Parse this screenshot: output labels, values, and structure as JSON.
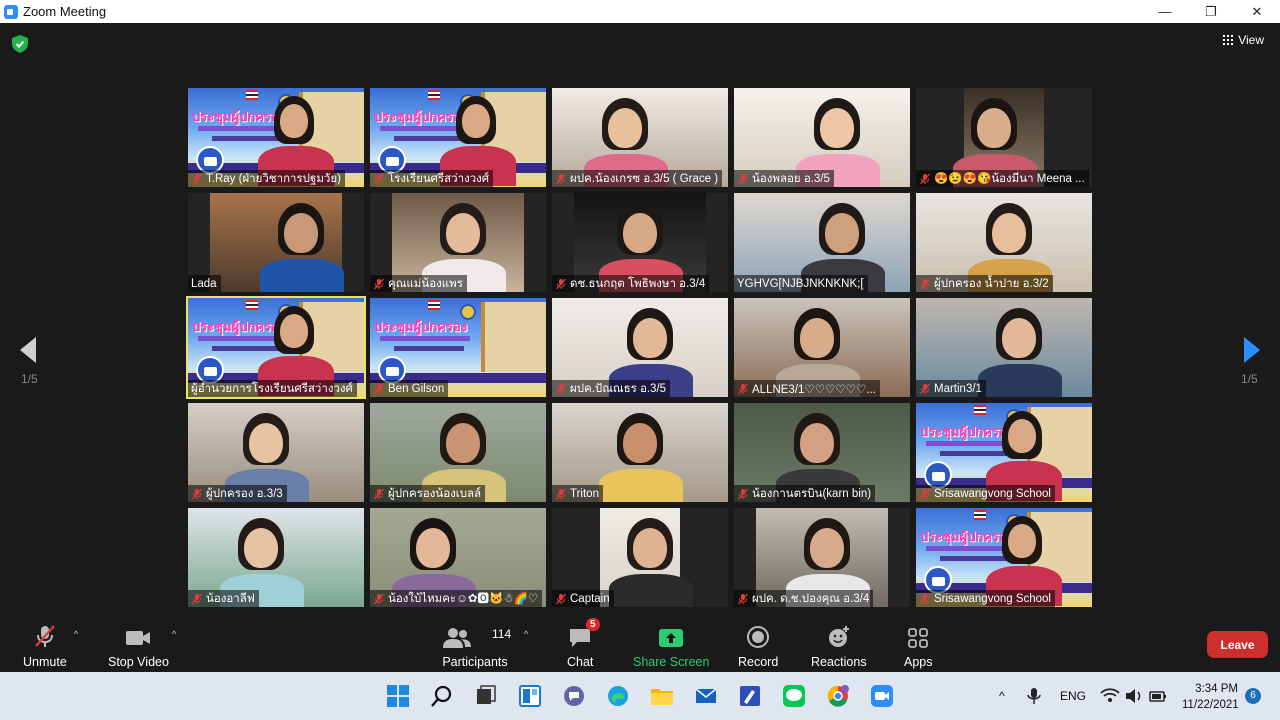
{
  "window": {
    "title": "Zoom Meeting",
    "minimize_glyph": "—",
    "restore_glyph": "❐",
    "close_glyph": "✕"
  },
  "meeting": {
    "view_label": "View",
    "page_left": "1/5",
    "page_right": "1/5",
    "banner_title": "ประชุมผู้ปกครอง"
  },
  "tiles": [
    {
      "name": "T.Ray (ฝ่ายวิชาการปฐมวัย)",
      "muted": true,
      "kind": "banner-person"
    },
    {
      "name": "โรงเรียนศรีสว่างวงศ์",
      "muted": true,
      "kind": "banner-person"
    },
    {
      "name": "ผปค.น้องเกรซ อ.3/5 ( Grace )",
      "muted": true,
      "kind": "person"
    },
    {
      "name": "น้องพลอย อ.3/5",
      "muted": true,
      "kind": "person"
    },
    {
      "name": "😍😉😍😘น้องมีนา Meena ...",
      "muted": true,
      "kind": "person"
    },
    {
      "name": "Lada",
      "muted": false,
      "kind": "person"
    },
    {
      "name": "คุณแม่น้องแพร",
      "muted": true,
      "kind": "person"
    },
    {
      "name": "ดช.ธนกฤต โพธิพงษา อ.3/4",
      "muted": true,
      "kind": "person"
    },
    {
      "name": "YGHVG[NJBJNKNKNK;[",
      "muted": false,
      "kind": "person"
    },
    {
      "name": "ผู้ปกครอง น้ำปาย อ.3/2",
      "muted": true,
      "kind": "person"
    },
    {
      "name": "ผู้อำนวยการโรงเรียนศรีสว่างวงศ์",
      "muted": false,
      "kind": "banner-person",
      "active": true
    },
    {
      "name": "Ben Gilson",
      "muted": true,
      "kind": "banner"
    },
    {
      "name": "ผปค.ปัณณธร อ.3/5",
      "muted": true,
      "kind": "person"
    },
    {
      "name": "ALLNE3/1♡♡♡♡♡♡...",
      "muted": true,
      "kind": "person"
    },
    {
      "name": "Martin3/1",
      "muted": true,
      "kind": "person"
    },
    {
      "name": "ผู้ปกครอง อ.3/3",
      "muted": true,
      "kind": "person"
    },
    {
      "name": "ผู้ปกครองน้องเบลล์",
      "muted": true,
      "kind": "person"
    },
    {
      "name": "Triton",
      "muted": true,
      "kind": "person"
    },
    {
      "name": "น้องกานตรบิน(karn bin)",
      "muted": true,
      "kind": "person"
    },
    {
      "name": "Srisawangvong School",
      "muted": true,
      "kind": "banner-person"
    },
    {
      "name": "น้องอาลีฟ",
      "muted": true,
      "kind": "person"
    },
    {
      "name": "น้องใบ้ไหมคะ☺✿🅾🐱☃🌈♡",
      "muted": true,
      "kind": "person"
    },
    {
      "name": "Captain",
      "muted": true,
      "kind": "person"
    },
    {
      "name": "ผปค. ด.ช.ปองคุณ อ.3/4",
      "muted": true,
      "kind": "person"
    },
    {
      "name": "Srisawangvong School",
      "muted": true,
      "kind": "banner-person"
    }
  ],
  "toolbar": {
    "unmute_label": "Unmute",
    "stop_video_label": "Stop Video",
    "participants_label": "Participants",
    "participants_count": "114",
    "chat_label": "Chat",
    "chat_badge": "5",
    "share_label": "Share Screen",
    "record_label": "Record",
    "reactions_label": "Reactions",
    "apps_label": "Apps",
    "leave_label": "Leave",
    "caret": "^"
  },
  "taskbar": {
    "language": "ENG",
    "time": "3:34 PM",
    "date": "11/22/2021",
    "notification_count": "6",
    "tray_chevron": "^"
  },
  "colors": {
    "accent": "#2d8cff",
    "share_green": "#2ecc71",
    "leave_red": "#cf2e2e",
    "active_speaker": "#e8e36a",
    "muted_red": "#e03c3c"
  }
}
